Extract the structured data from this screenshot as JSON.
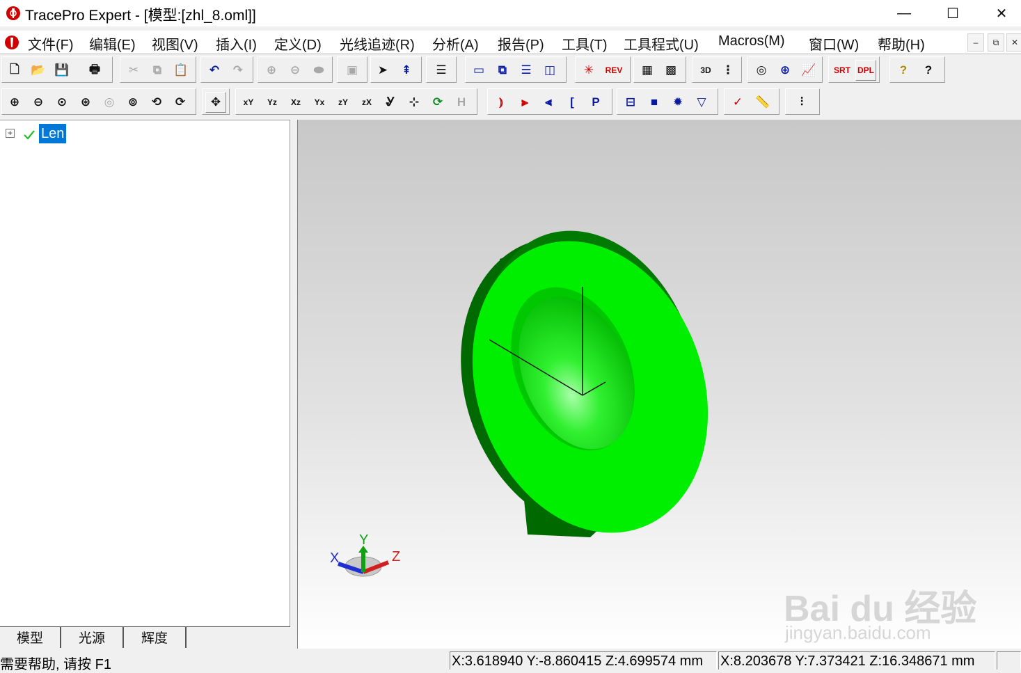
{
  "window": {
    "title": "TracePro Expert - [模型:[zhl_8.oml]]",
    "minimize_glyph": "—",
    "maximize_glyph": "☐",
    "close_glyph": "✕"
  },
  "menu": {
    "items": [
      "文件(F)",
      "编辑(E)",
      "视图(V)",
      "插入(I)",
      "定义(D)",
      "光线追迹(R)",
      "分析(A)",
      "报告(P)",
      "工具(T)",
      "工具程式(U)",
      "Macros(M)",
      "窗口(W)",
      "帮助(H)"
    ],
    "mdi_minimize": "–",
    "mdi_restore": "⧉",
    "mdi_close": "✕"
  },
  "toolbar1": {
    "new": "🗋",
    "open": "📂",
    "save": "💾",
    "print": "🖶",
    "cut": "✂",
    "copy": "⧉",
    "paste": "📋",
    "undo": "↶",
    "redo": "↷",
    "bool_union": "⊕",
    "bool_subtract": "⊖",
    "bool_intersect": "⬬",
    "properties": "▣",
    "select_object": "➤",
    "select_surface": "⇞",
    "notes": "☰",
    "view_model": "▭",
    "view_cascade": "⧉",
    "view_tile_h": "☰",
    "view_tile_v": "◫",
    "raytrace": "✳",
    "raytrace_rev": "REV",
    "irradiance_map": "▦",
    "candela_map": "▩",
    "display_3d": "3D",
    "display_rays": "⋮",
    "source_props": "◎",
    "globe": "⊕",
    "plot": "📈",
    "srt": "SRT",
    "dpl": "DPL",
    "help": "?",
    "context_help": "?"
  },
  "toolbar2": {
    "zoom_in": "⊕",
    "zoom_out": "⊖",
    "zoom_window": "⊙",
    "zoom_all": "⊛",
    "zoom_prev": "◎",
    "zoom_select": "⊚",
    "rotate": "⟲",
    "rotate2": "⟳",
    "pan": "✥",
    "view_xy": "xY",
    "view_yz": "Yz",
    "view_xz": "Xz",
    "view_yx": "Yx",
    "view_zy": "zY",
    "view_zx": "zX",
    "view_iso": "Ꮍ",
    "view_axes": "⊹",
    "view_rotate": "⟳",
    "view_h": "H",
    "lens": "⦆",
    "mirror": "⫸",
    "prism": "⫷",
    "bracket": "[",
    "p": "P",
    "box": "⊟",
    "block": "■",
    "sphere": "✹",
    "cone": "▽",
    "check": "✓",
    "ruler": "📏",
    "wave": "⫶"
  },
  "tree": {
    "root_label": "Len",
    "expander": "+",
    "checked": true
  },
  "tabs": [
    "模型",
    "光源",
    "辉度"
  ],
  "viewport": {
    "triad_x": "X",
    "triad_y": "Y",
    "triad_z": "Z",
    "object_color": "#00ee00",
    "object_shadow_color": "#005a00",
    "watermark_logo": "Bai du 经验",
    "watermark_url": "jingyan.baidu.com"
  },
  "status": {
    "help_text": "需要帮助, 请按 F1",
    "coords_1": "X:3.618940 Y:-8.860415 Z:4.699574 mm",
    "coords_2": "X:8.203678 Y:7.373421 Z:16.348671 mm"
  }
}
